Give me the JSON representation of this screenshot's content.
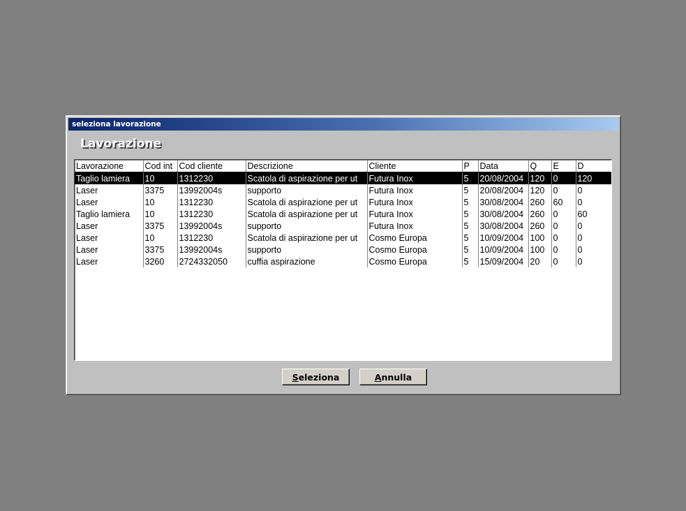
{
  "dialog": {
    "title": "seleziona lavorazione",
    "header": "Lavorazione"
  },
  "table": {
    "columns": [
      "Lavorazione",
      "Cod int",
      "Cod cliente",
      "Descrizione",
      "Cliente",
      "P",
      "Data",
      "Q",
      "E",
      "D"
    ],
    "selected_row": 0,
    "rows": [
      [
        "Taglio lamiera",
        "10",
        "1312230",
        "Scatola di aspirazione per ut",
        "Futura Inox",
        "5",
        "20/08/2004",
        "120",
        "0",
        "120"
      ],
      [
        "Laser",
        "3375",
        "13992004s",
        "supporto",
        "Futura Inox",
        "5",
        "20/08/2004",
        "120",
        "0",
        "0"
      ],
      [
        "Laser",
        "10",
        "1312230",
        "Scatola di aspirazione per ut",
        "Futura Inox",
        "5",
        "30/08/2004",
        "260",
        "60",
        "0"
      ],
      [
        "Taglio lamiera",
        "10",
        "1312230",
        "Scatola di aspirazione per ut",
        "Futura Inox",
        "5",
        "30/08/2004",
        "260",
        "0",
        "60"
      ],
      [
        "Laser",
        "3375",
        "13992004s",
        "supporto",
        "Futura Inox",
        "5",
        "30/08/2004",
        "260",
        "0",
        "0"
      ],
      [
        "Laser",
        "10",
        "1312230",
        "Scatola di aspirazione per ut",
        "Cosmo Europa",
        "5",
        "10/09/2004",
        "100",
        "0",
        "0"
      ],
      [
        "Laser",
        "3375",
        "13992004s",
        "supporto",
        "Cosmo Europa",
        "5",
        "10/09/2004",
        "100",
        "0",
        "0"
      ],
      [
        "Laser",
        "3260",
        "2724332050",
        "cuffia aspirazione",
        "Cosmo Europa",
        "5",
        "15/09/2004",
        "20",
        "0",
        "0"
      ]
    ]
  },
  "buttons": {
    "select": {
      "mnemonic": "S",
      "rest": "eleziona"
    },
    "cancel": {
      "mnemonic": "A",
      "rest": "nnulla"
    }
  }
}
